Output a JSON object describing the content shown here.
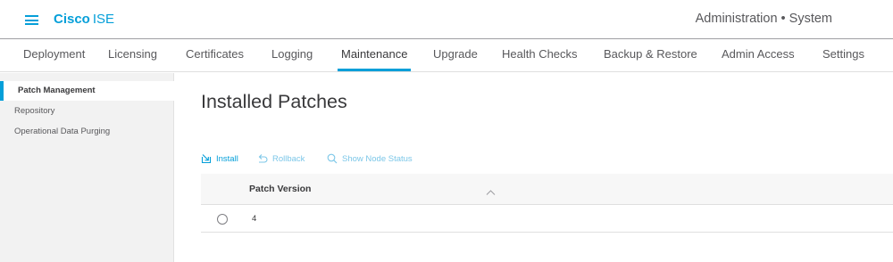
{
  "header": {
    "brand_cisco": "Cisco",
    "brand_product": "ISE",
    "context_title": "Administration • System"
  },
  "tabs": [
    {
      "label": "Deployment"
    },
    {
      "label": "Licensing"
    },
    {
      "label": "Certificates"
    },
    {
      "label": "Logging"
    },
    {
      "label": "Maintenance",
      "active": true
    },
    {
      "label": "Upgrade"
    },
    {
      "label": "Health Checks"
    },
    {
      "label": "Backup & Restore"
    },
    {
      "label": "Admin Access"
    },
    {
      "label": "Settings"
    }
  ],
  "sidebar": {
    "items": [
      {
        "label": "Patch Management",
        "active": true
      },
      {
        "label": "Repository"
      },
      {
        "label": "Operational Data Purging"
      }
    ]
  },
  "main": {
    "title": "Installed Patches",
    "toolbar": {
      "install_label": "Install",
      "rollback_label": "Rollback",
      "show_status_label": "Show Node Status"
    },
    "table": {
      "column_header": "Patch Version",
      "rows": [
        {
          "version": "4"
        }
      ]
    }
  },
  "colors": {
    "accent": "#049fd9",
    "accent_disabled": "#7cc7e8",
    "sidebar_bg": "#f2f2f2"
  },
  "icons": {
    "menu": "hamburger-menu-icon",
    "install": "install-icon",
    "rollback": "rollback-arrow-icon",
    "status": "magnifier-icon",
    "sort": "chevron-up-icon"
  }
}
